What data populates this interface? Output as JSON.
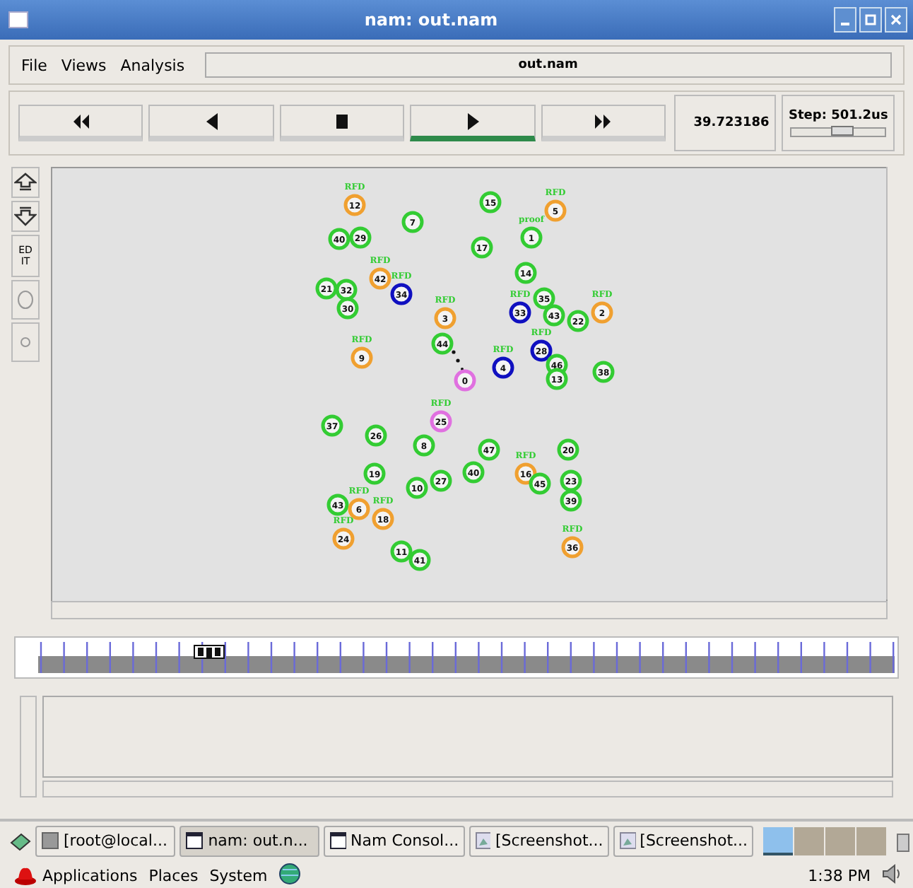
{
  "window": {
    "title": "nam: out.nam"
  },
  "menu": [
    "File",
    "Views",
    "Analysis"
  ],
  "file_field": {
    "value": "out.nam"
  },
  "controls": [
    {
      "kind": "rewind",
      "selected": false
    },
    {
      "kind": "back",
      "selected": false
    },
    {
      "kind": "stop",
      "selected": false
    },
    {
      "kind": "play",
      "selected": true
    },
    {
      "kind": "forward",
      "selected": false
    }
  ],
  "time": "39.723186",
  "step": {
    "label": "Step: 501.2us",
    "level": 0.55
  },
  "tools": [
    {
      "kind": "zoom-in"
    },
    {
      "kind": "zoom-out"
    },
    {
      "kind": "edit",
      "label": "EDIT"
    },
    {
      "kind": "big-circle"
    },
    {
      "kind": "small-circle"
    }
  ],
  "nodes": [
    {
      "id": "12",
      "color": "#f0a030",
      "tag": "RFD"
    },
    {
      "id": "7",
      "color": "#33cc33"
    },
    {
      "id": "15",
      "color": "#33cc33"
    },
    {
      "id": "5",
      "color": "#f0a030",
      "tag": "RFD"
    },
    {
      "id": "40",
      "color": "#33cc33"
    },
    {
      "id": "29",
      "color": "#33cc33"
    },
    {
      "id": "17",
      "color": "#33cc33"
    },
    {
      "id": "1",
      "color": "#33cc33",
      "tag": "proof"
    },
    {
      "id": "21",
      "color": "#33cc33"
    },
    {
      "id": "32",
      "color": "#33cc33"
    },
    {
      "id": "30",
      "color": "#33cc33"
    },
    {
      "id": "42",
      "color": "#f0a030",
      "tag": "RFD"
    },
    {
      "id": "34",
      "color": "#1010c0",
      "tag": "RFD"
    },
    {
      "id": "3",
      "color": "#f0a030",
      "tag": "RFD"
    },
    {
      "id": "14",
      "color": "#33cc33"
    },
    {
      "id": "33",
      "color": "#1010c0",
      "tag": "RFD"
    },
    {
      "id": "35",
      "color": "#33cc33"
    },
    {
      "id": "43",
      "color": "#33cc33"
    },
    {
      "id": "22",
      "color": "#33cc33"
    },
    {
      "id": "2",
      "color": "#f0a030",
      "tag": "RFD"
    },
    {
      "id": "9",
      "color": "#f0a030",
      "tag": "RFD"
    },
    {
      "id": "44",
      "color": "#33cc33"
    },
    {
      "id": "0",
      "color": "#e070e0"
    },
    {
      "id": "4",
      "color": "#1010c0",
      "tag": "RFD"
    },
    {
      "id": "28",
      "color": "#1010c0",
      "tag": "RFD"
    },
    {
      "id": "46",
      "color": "#33cc33"
    },
    {
      "id": "13",
      "color": "#33cc33"
    },
    {
      "id": "38",
      "color": "#33cc33"
    },
    {
      "id": "37",
      "color": "#33cc33"
    },
    {
      "id": "26",
      "color": "#33cc33"
    },
    {
      "id": "25",
      "color": "#e070e0",
      "tag": "RFD"
    },
    {
      "id": "8",
      "color": "#33cc33"
    },
    {
      "id": "47",
      "color": "#33cc33"
    },
    {
      "id": "20",
      "color": "#33cc33"
    },
    {
      "id": "19",
      "color": "#33cc33"
    },
    {
      "id": "10",
      "color": "#33cc33"
    },
    {
      "id": "27",
      "color": "#33cc33"
    },
    {
      "id": "40",
      "color": "#33cc33"
    },
    {
      "id": "16",
      "color": "#f0a030",
      "tag": "RFD"
    },
    {
      "id": "45",
      "color": "#33cc33"
    },
    {
      "id": "23",
      "color": "#33cc33"
    },
    {
      "id": "43",
      "color": "#33cc33"
    },
    {
      "id": "6",
      "color": "#f0a030",
      "tag": "RFD"
    },
    {
      "id": "18",
      "color": "#f0a030",
      "tag": "RFD"
    },
    {
      "id": "39",
      "color": "#33cc33"
    },
    {
      "id": "24",
      "color": "#f0a030",
      "tag": "RFD"
    },
    {
      "id": "11",
      "color": "#33cc33"
    },
    {
      "id": "41",
      "color": "#33cc33"
    },
    {
      "id": "36",
      "color": "#f0a030",
      "tag": "RFD"
    }
  ],
  "taskbar": [
    {
      "label": "[root@local...",
      "kind": "terminal",
      "selected": false
    },
    {
      "label": "nam: out.n...",
      "kind": "window",
      "selected": true
    },
    {
      "label": "Nam Consol...",
      "kind": "window",
      "selected": false
    },
    {
      "label": "[Screenshot...",
      "kind": "image",
      "selected": false
    },
    {
      "label": "[Screenshot...",
      "kind": "image",
      "selected": false
    }
  ],
  "workspaces": [
    {
      "selected": true
    },
    {
      "selected": false
    },
    {
      "selected": false
    },
    {
      "selected": false
    }
  ],
  "panel_menu": [
    "Applications",
    "Places",
    "System"
  ],
  "clock": "1:38 PM"
}
